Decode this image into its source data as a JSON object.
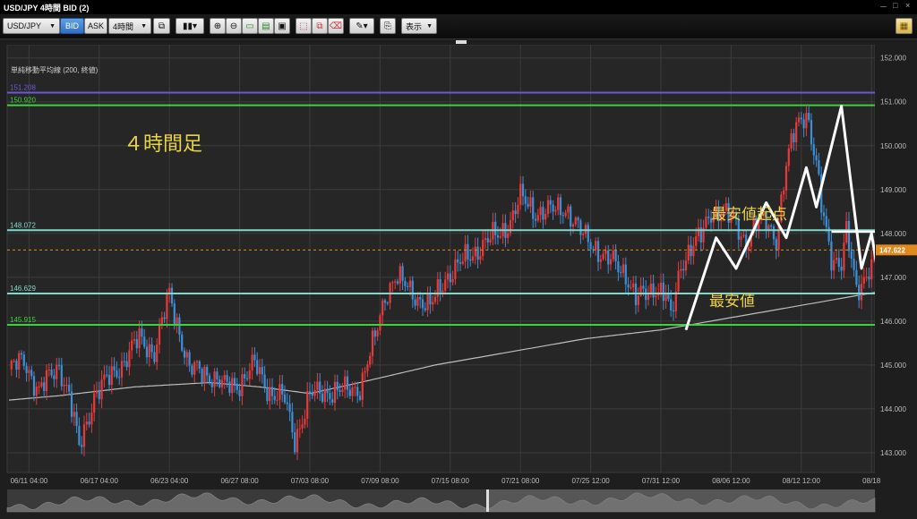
{
  "window": {
    "title": "USD/JPY 4時間 BID (2)",
    "controls": [
      "－",
      "□",
      "×"
    ]
  },
  "toolbar": {
    "symbol": "USD/JPY",
    "bid_label": "BID",
    "ask_label": "ASK",
    "timeframe": "4時間",
    "display_label": "表示"
  },
  "chart_data": {
    "type": "candlestick",
    "indicator_label": "単純移動平均線 (200, 終値)",
    "annotation_title": "４時間足",
    "annotation_high_start": "最安値起点",
    "annotation_low": "最安値",
    "current_price_label": "147.622",
    "current_price": 147.622,
    "y_ticks": [
      "152.000",
      "151.000",
      "150.000",
      "149.000",
      "148.000",
      "147.000",
      "146.000",
      "145.000",
      "144.000",
      "143.000"
    ],
    "y_tick_values": [
      152,
      151,
      150,
      149,
      148,
      147,
      146,
      145,
      144,
      143
    ],
    "ylim": [
      142.55,
      152.3
    ],
    "x_ticks": [
      "06/11 04:00",
      "06/17 04:00",
      "06/23 04:00",
      "06/27 08:00",
      "07/03 08:00",
      "07/09 08:00",
      "07/15 08:00",
      "07/21 08:00",
      "07/25 12:00",
      "07/31 12:00",
      "08/06 12:00",
      "08/12 12:00",
      "08/18"
    ],
    "x_tick_index": [
      8,
      36,
      64,
      92,
      120,
      148,
      176,
      204,
      232,
      260,
      288,
      316,
      344
    ],
    "horizontal_lines": [
      {
        "label": "151.208",
        "value": 151.208,
        "color": "#6a5ad0"
      },
      {
        "label": "150.920",
        "value": 150.92,
        "color": "#3cd23c"
      },
      {
        "label": "148.072",
        "value": 148.072,
        "color": "#7fd8c9"
      },
      {
        "label": "146.629",
        "value": 146.629,
        "color": "#7fd8c9"
      },
      {
        "label": "145.915",
        "value": 145.915,
        "color": "#3cd23c"
      }
    ],
    "colors": {
      "up": "#e83a3a",
      "down": "#3d8fd8",
      "sma": "#bdbdbd",
      "annotation": "#e8d24a",
      "zigzag": "#ffffff",
      "current": "#e08a1e"
    },
    "close_waypoints": [
      [
        0,
        144.9
      ],
      [
        6,
        145.1
      ],
      [
        12,
        144.4
      ],
      [
        20,
        145.0
      ],
      [
        24,
        144.3
      ],
      [
        28,
        143.1
      ],
      [
        34,
        144.3
      ],
      [
        40,
        144.7
      ],
      [
        46,
        145.1
      ],
      [
        52,
        145.6
      ],
      [
        58,
        145.3
      ],
      [
        64,
        146.6
      ],
      [
        66,
        146.2
      ],
      [
        72,
        144.9
      ],
      [
        80,
        144.8
      ],
      [
        86,
        144.5
      ],
      [
        92,
        144.6
      ],
      [
        98,
        145.0
      ],
      [
        104,
        144.4
      ],
      [
        110,
        144.2
      ],
      [
        114,
        143.3
      ],
      [
        120,
        144.3
      ],
      [
        126,
        144.4
      ],
      [
        134,
        144.4
      ],
      [
        140,
        144.5
      ],
      [
        146,
        145.6
      ],
      [
        150,
        146.6
      ],
      [
        154,
        147.0
      ],
      [
        162,
        146.6
      ],
      [
        168,
        146.3
      ],
      [
        174,
        147.0
      ],
      [
        182,
        147.4
      ],
      [
        190,
        147.8
      ],
      [
        196,
        148.0
      ],
      [
        200,
        148.3
      ],
      [
        204,
        148.8
      ],
      [
        210,
        148.5
      ],
      [
        216,
        148.5
      ],
      [
        222,
        148.6
      ],
      [
        228,
        148.0
      ],
      [
        234,
        147.7
      ],
      [
        238,
        147.4
      ],
      [
        242,
        147.3
      ],
      [
        246,
        147.1
      ],
      [
        250,
        146.5
      ],
      [
        254,
        146.6
      ],
      [
        258,
        146.8
      ],
      [
        262,
        146.6
      ],
      [
        264,
        146.0
      ],
      [
        268,
        147.3
      ],
      [
        272,
        147.7
      ],
      [
        276,
        147.9
      ],
      [
        280,
        148.5
      ],
      [
        284,
        148.5
      ],
      [
        290,
        148.2
      ],
      [
        294,
        147.8
      ],
      [
        298,
        148.2
      ],
      [
        302,
        148.3
      ],
      [
        306,
        147.9
      ],
      [
        310,
        149.5
      ],
      [
        314,
        150.5
      ],
      [
        318,
        150.8
      ],
      [
        322,
        149.5
      ],
      [
        324,
        148.6
      ],
      [
        328,
        147.5
      ],
      [
        332,
        147.3
      ],
      [
        334,
        148.0
      ],
      [
        338,
        146.7
      ],
      [
        342,
        147.1
      ],
      [
        346,
        147.5
      ],
      [
        350,
        147.622
      ]
    ],
    "sma_waypoints": [
      [
        0,
        144.2
      ],
      [
        20,
        144.3
      ],
      [
        50,
        144.5
      ],
      [
        80,
        144.6
      ],
      [
        100,
        144.5
      ],
      [
        120,
        144.35
      ],
      [
        140,
        144.6
      ],
      [
        170,
        145.0
      ],
      [
        200,
        145.3
      ],
      [
        230,
        145.6
      ],
      [
        260,
        145.8
      ],
      [
        290,
        146.1
      ],
      [
        320,
        146.4
      ],
      [
        350,
        146.7
      ]
    ],
    "zigzag": [
      [
        270,
        145.8
      ],
      [
        282,
        147.9
      ],
      [
        290,
        147.2
      ],
      [
        302,
        148.7
      ],
      [
        310,
        147.9
      ],
      [
        318,
        149.5
      ],
      [
        322,
        148.6
      ],
      [
        332,
        150.9
      ],
      [
        340,
        147.2
      ],
      [
        344,
        148.0
      ],
      [
        348,
        146.6
      ]
    ],
    "support_line": {
      "from_index": 328,
      "to_index": 388,
      "value": 148.04
    },
    "low_line": {
      "from_index": 346,
      "to_index": 388,
      "value": 146.65
    }
  }
}
